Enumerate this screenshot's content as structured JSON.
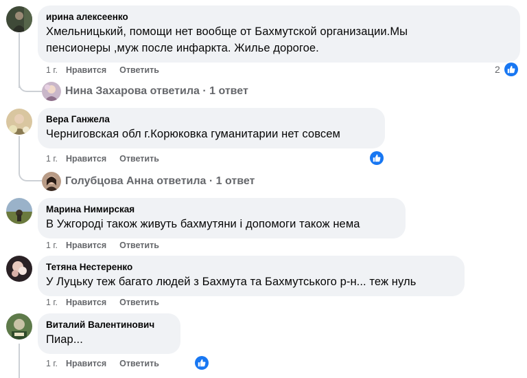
{
  "comments": [
    {
      "author": "ирина алексеенко",
      "text": "Хмельницький, помощи нет вообще от Бахмутской организации.Мы\nпенсионеры ,муж после инфаркта. Жилье дорогое.",
      "time": "1 г.",
      "like_label": "Нравится",
      "reply_label": "Ответить",
      "reaction_count": "2",
      "replies_summary": "Нина Захарова ответила · 1 ответ"
    },
    {
      "author": "Вера Ганжела",
      "text": "Черниговская обл г.Корюковка гуманитарии нет совсем",
      "time": "1 г.",
      "like_label": "Нравится",
      "reply_label": "Ответить",
      "replies_summary": "Голубцова Анна ответила · 1 ответ"
    },
    {
      "author": "Марина Нимирская",
      "text": "В Ужгороді також живуть бахмутяни і допомоги також нема",
      "time": "1 г.",
      "like_label": "Нравится",
      "reply_label": "Ответить"
    },
    {
      "author": "Тетяна Нестеренко",
      "text": "У Луцьку теж багато людей з Бахмута та Бахмутського р-н... теж нуль",
      "time": "1 г.",
      "like_label": "Нравится",
      "reply_label": "Ответить"
    },
    {
      "author": "Виталий Валентинович",
      "text": "Пиар...",
      "time": "1 г.",
      "like_label": "Нравится",
      "reply_label": "Ответить"
    }
  ],
  "colors": {
    "bubble": "#f0f2f5",
    "secondary_text": "#65676b",
    "like_blue": "#1877f2",
    "thread_line": "#ccd0d5"
  },
  "icons": {
    "reaction": "thumbs-up-icon"
  }
}
